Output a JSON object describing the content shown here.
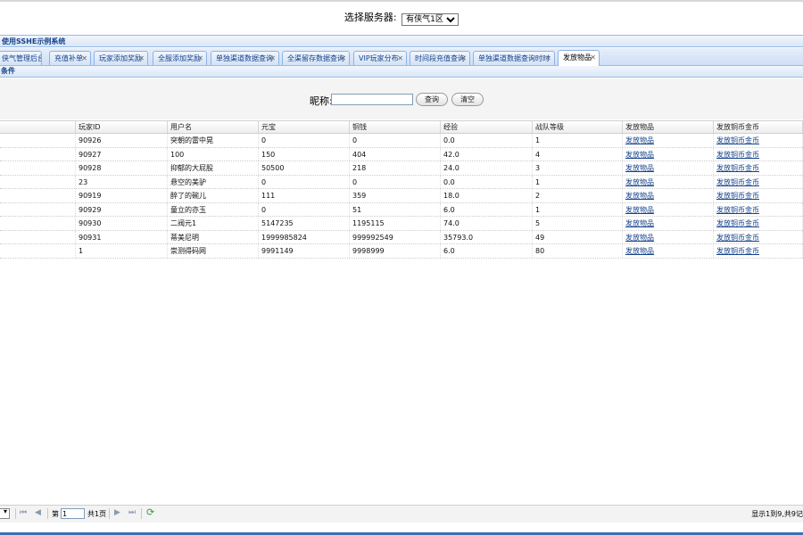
{
  "server": {
    "label": "选择服务器:",
    "selected": "有侠气1区"
  },
  "system_title": "使用SSHE示例系统",
  "tabs": [
    {
      "label": "侠气管理后台",
      "closable": false,
      "active": false
    },
    {
      "label": "充值补单",
      "closable": true,
      "active": false
    },
    {
      "label": "玩家添加奖励",
      "closable": true,
      "active": false
    },
    {
      "label": "全服添加奖励",
      "closable": true,
      "active": false
    },
    {
      "label": "单独渠道数据查询",
      "closable": true,
      "active": false
    },
    {
      "label": "全渠留存数据查询",
      "closable": true,
      "active": false
    },
    {
      "label": "VIP玩家分布",
      "closable": true,
      "active": false
    },
    {
      "label": "时间段充值查询",
      "closable": true,
      "active": false
    },
    {
      "label": "单独渠道数据查询时时",
      "closable": true,
      "active": false
    },
    {
      "label": "发放物品",
      "closable": true,
      "active": true
    }
  ],
  "condition_title": "条件",
  "search": {
    "label": "昵称:",
    "value": "",
    "query_btn": "查询",
    "clear_btn": "清空"
  },
  "table": {
    "columns": [
      "",
      "玩家ID",
      "用户名",
      "元宝",
      "铜钱",
      "经验",
      "战队等级",
      "发放物品",
      "发放铜币金币"
    ],
    "rows": [
      {
        "id": "90926",
        "name": "突朝的雷中晃",
        "yuanbao": "0",
        "tongqian": "0",
        "exp": "0.0",
        "level": "1",
        "item_link": "发放物品",
        "coin_link": "发放铜币金币"
      },
      {
        "id": "90927",
        "name": "100",
        "yuanbao": "150",
        "tongqian": "404",
        "exp": "42.0",
        "level": "4",
        "item_link": "发放物品",
        "coin_link": "发放铜币金币"
      },
      {
        "id": "90928",
        "name": "抑郁的大屁股",
        "yuanbao": "50500",
        "tongqian": "218",
        "exp": "24.0",
        "level": "3",
        "item_link": "发放物品",
        "coin_link": "发放铜币金币"
      },
      {
        "id": "23",
        "name": "悬空的美驴",
        "yuanbao": "0",
        "tongqian": "0",
        "exp": "0.0",
        "level": "1",
        "item_link": "发放物品",
        "coin_link": "发放铜币金币"
      },
      {
        "id": "90919",
        "name": "醉了的碗儿",
        "yuanbao": "111",
        "tongqian": "359",
        "exp": "18.0",
        "level": "2",
        "item_link": "发放物品",
        "coin_link": "发放铜币金币"
      },
      {
        "id": "90929",
        "name": "童立的亦玉",
        "yuanbao": "0",
        "tongqian": "51",
        "exp": "6.0",
        "level": "1",
        "item_link": "发放物品",
        "coin_link": "发放铜币金币"
      },
      {
        "id": "90930",
        "name": "二阀元1",
        "yuanbao": "5147235",
        "tongqian": "1195115",
        "exp": "74.0",
        "level": "5",
        "item_link": "发放物品",
        "coin_link": "发放铜币金币"
      },
      {
        "id": "90931",
        "name": "蒂美尼明",
        "yuanbao": "1999985824",
        "tongqian": "999992549",
        "exp": "35793.0",
        "level": "49",
        "item_link": "发放物品",
        "coin_link": "发放铜币金币"
      },
      {
        "id": "1",
        "name": "崇测得码网",
        "yuanbao": "9991149",
        "tongqian": "9998999",
        "exp": "6.0",
        "level": "80",
        "item_link": "发放物品",
        "coin_link": "发放铜币金币"
      }
    ]
  },
  "pager": {
    "page_label": "第",
    "page_value": "1",
    "total_label": "共1页",
    "info": "显示1到9,共9记"
  }
}
